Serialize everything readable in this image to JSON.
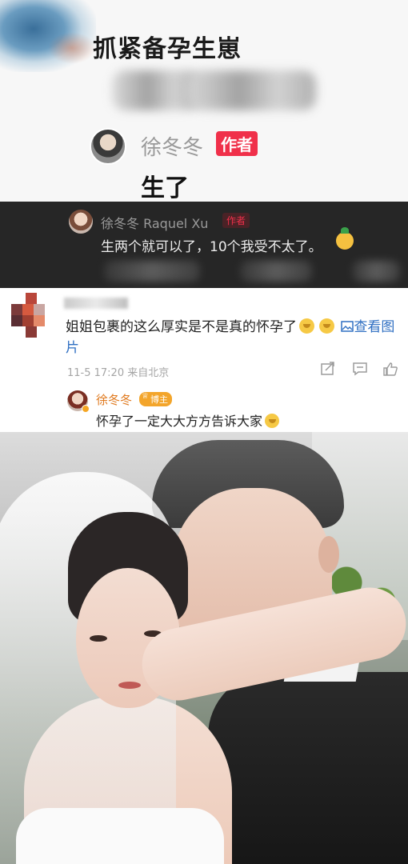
{
  "panel1": {
    "title": "抓紧备孕生崽",
    "author_name": "徐冬冬",
    "author_badge": "作者",
    "reply_text": "生了"
  },
  "panel2": {
    "author_name": "徐冬冬 Raquel Xu",
    "author_badge": "作者",
    "reply_text": "生两个就可以了，10个我受不太了。"
  },
  "panel3": {
    "comment_text": "姐姐包裹的这么厚实是不是真的怀孕了",
    "view_image_text": "查看图片",
    "meta": "11-5 17:20 来自北京",
    "reply_author": "徐冬冬",
    "reply_badge": "博主",
    "reply_text": "怀孕了一定大大方方告诉大家",
    "accent_color": "#2f6fc2",
    "icons": [
      "share-icon",
      "comment-icon",
      "like-icon",
      "picture-icon"
    ]
  },
  "colors": {
    "author_badge": "#f0304a",
    "blogger_name": "#e07a1f",
    "dark_bg": "#262626"
  }
}
